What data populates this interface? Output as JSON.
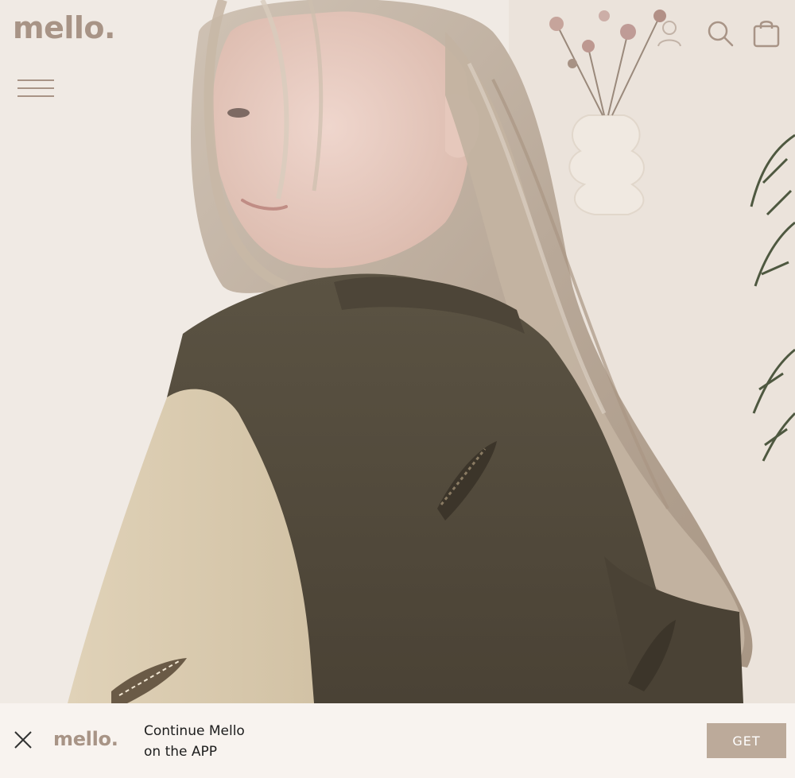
{
  "header": {
    "logo": "mello.",
    "icons": [
      "menu-icon",
      "user-icon",
      "search-icon",
      "bag-icon"
    ]
  },
  "hero": {
    "image": "hero-photo"
  },
  "app_banner": {
    "logo": "mello.",
    "line1": "Continue Mello",
    "line2": "on the APP",
    "cta": "GET"
  },
  "colors": {
    "brand": "#a89486",
    "button": "#bcaa9a",
    "banner_bg": "#f8f3ef",
    "text": "#1d1d1d"
  }
}
